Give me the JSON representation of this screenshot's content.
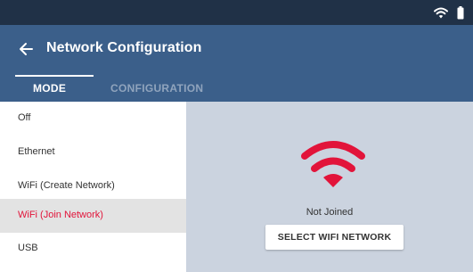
{
  "header": {
    "title": "Network Configuration",
    "back_icon": "arrow-left-icon"
  },
  "status_bar": {
    "icons": [
      "wifi-icon",
      "battery-icon"
    ]
  },
  "tabs": [
    {
      "label": "MODE",
      "active": true
    },
    {
      "label": "CONFIGURATION",
      "active": false
    }
  ],
  "modes": [
    {
      "label": "Off",
      "selected": false
    },
    {
      "label": "Ethernet",
      "selected": false
    },
    {
      "label": "WiFi (Create Network)",
      "selected": false
    },
    {
      "label": "WiFi (Join Network)",
      "selected": true
    },
    {
      "label": "USB",
      "selected": false
    }
  ],
  "panel": {
    "icon": "wifi-icon",
    "status": "Not Joined",
    "button_label": "SELECT WIFI NETWORK"
  },
  "colors": {
    "status_bar": "#203147",
    "app_bar": "#3b5f8a",
    "accent": "#e2143a",
    "panel_bg": "#cbd3df"
  }
}
